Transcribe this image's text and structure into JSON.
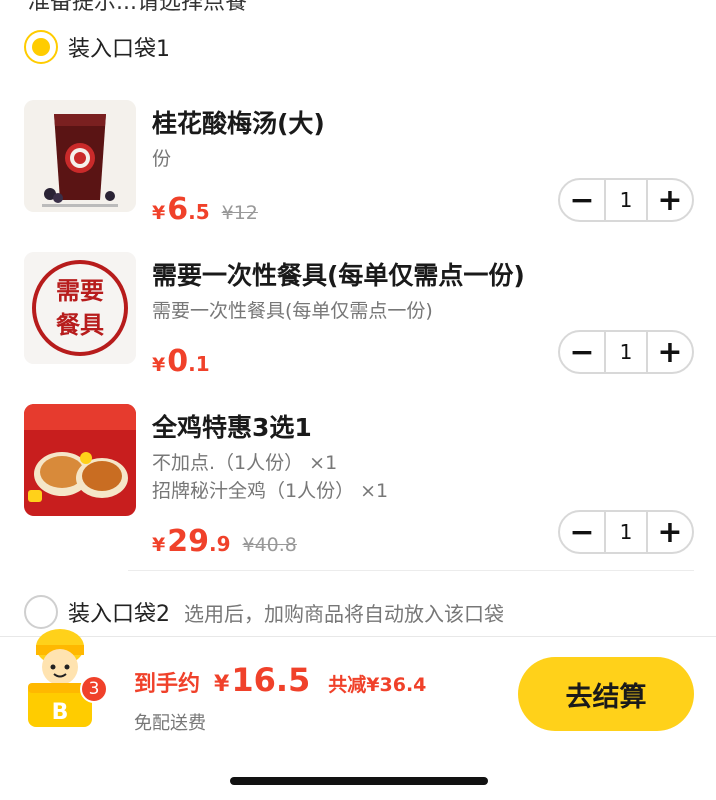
{
  "top_clipped_text": "准备提示...请选择点餐",
  "bag1": {
    "label": "装入口袋1",
    "selected": true
  },
  "items": [
    {
      "name": "桂花酸梅汤(大)",
      "desc_lines": [
        "份"
      ],
      "price_yen": "¥",
      "price_int": "6",
      "price_dec": ".5",
      "original_price": "¥12",
      "qty": "1",
      "thumb": "sour-plum-drink-image"
    },
    {
      "name": "需要一次性餐具(每单仅需点一份)",
      "desc_lines": [
        "需要一次性餐具(每单仅需点一份)"
      ],
      "price_yen": "¥",
      "price_int": "0",
      "price_dec": ".1",
      "original_price": "",
      "qty": "1",
      "thumb": "tableware-stamp-image",
      "thumb_text_1": "需要",
      "thumb_text_2": "餐具"
    },
    {
      "name": "全鸡特惠3选1",
      "desc_lines": [
        "不加点.（1人份） ×1",
        "招牌秘汁全鸡（1人份） ×1"
      ],
      "price_yen": "¥",
      "price_int": "29",
      "price_dec": ".9",
      "original_price": "¥40.8",
      "qty": "1",
      "thumb": "whole-chicken-image"
    }
  ],
  "stepper": {
    "minus": "−",
    "plus": "+"
  },
  "bag2": {
    "label": "装入口袋2",
    "hint": "选用后，加购商品将自动放入该口袋",
    "selected": false
  },
  "footer": {
    "badge_count": "3",
    "total_label": "到手约",
    "total_yen": "¥",
    "total_amount": "16.5",
    "discount": "共减¥36.4",
    "delivery": "免配送费",
    "checkout_label": "去结算"
  },
  "colors": {
    "accent_yellow": "#ffd11a",
    "price_red": "#f0412a"
  }
}
